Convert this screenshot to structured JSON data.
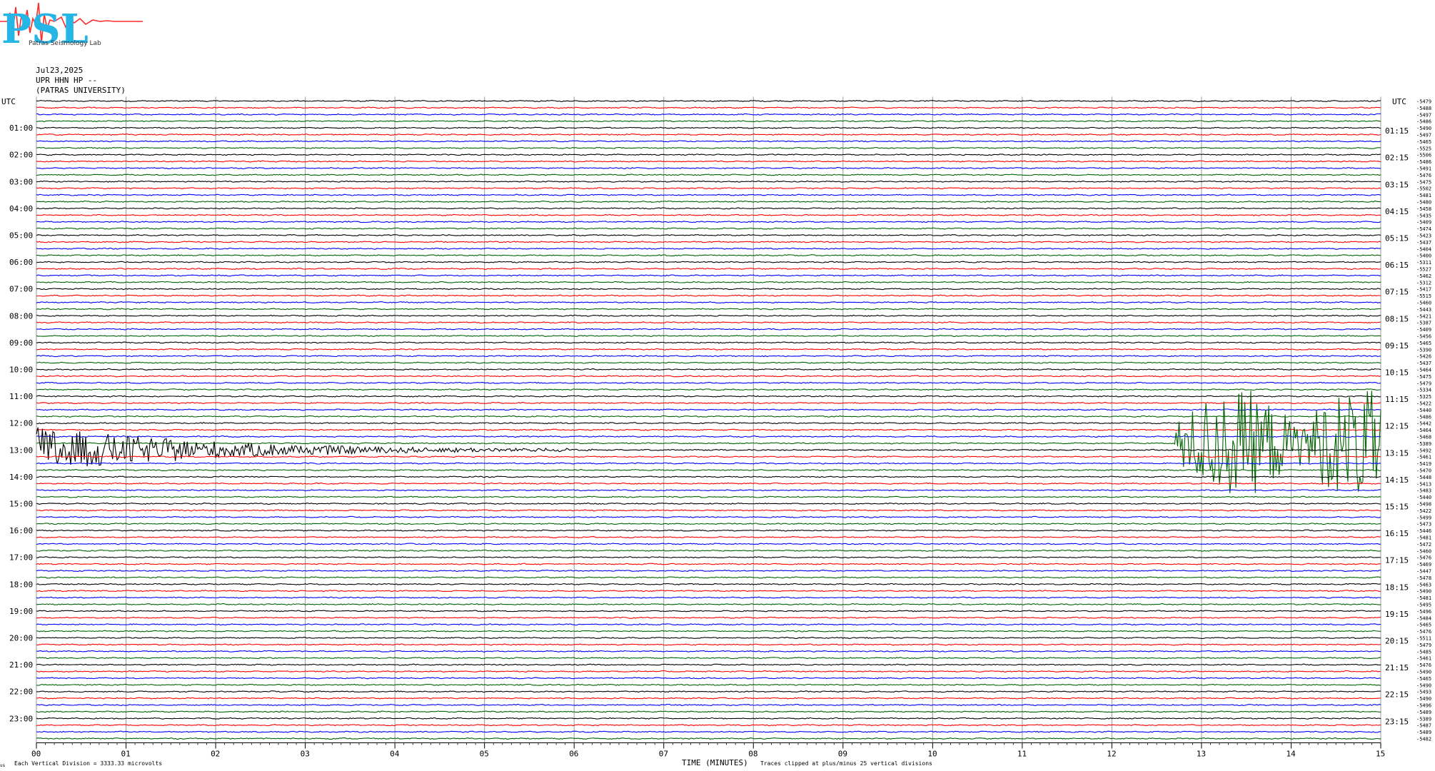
{
  "header": {
    "logo_text": "PSL",
    "logo_subtext": "Patras Seismology Lab",
    "date": "Jul23,2025",
    "station": "UPR HHN HP --",
    "institution": "(PATRAS UNIVERSITY)"
  },
  "axes": {
    "left_unit": "UTC",
    "right_unit": "UTC",
    "xlabel": "TIME (MINUTES)",
    "footer_left": "Each Vertical Division = 3333.33 microvolts",
    "footer_right": "Traces clipped at plus/minus 25 vertical divisions",
    "corner_mark": "us"
  },
  "chart_data": {
    "type": "line",
    "xlim": [
      0,
      15
    ],
    "x_ticks": [
      "00",
      "01",
      "02",
      "03",
      "04",
      "05",
      "06",
      "07",
      "08",
      "09",
      "10",
      "11",
      "12",
      "13",
      "14",
      "15"
    ],
    "grid": "vertical",
    "trace_count": 96,
    "trace_minutes": 15,
    "trace_colors": [
      "#000000",
      "#ff0000",
      "#0000ff",
      "#006400"
    ],
    "left_hour_labels": [
      "01:00",
      "02:00",
      "03:00",
      "04:00",
      "05:00",
      "06:00",
      "07:00",
      "08:00",
      "09:00",
      "10:00",
      "11:00",
      "12:00",
      "13:00",
      "14:00",
      "15:00",
      "16:00",
      "17:00",
      "18:00",
      "19:00",
      "20:00",
      "21:00",
      "22:00",
      "23:00"
    ],
    "right_hour_labels": [
      "01:15",
      "02:15",
      "03:15",
      "04:15",
      "05:15",
      "06:15",
      "07:15",
      "08:15",
      "09:15",
      "10:15",
      "11:15",
      "12:15",
      "13:15",
      "14:15",
      "15:15",
      "16:15",
      "17:15",
      "18:15",
      "19:15",
      "20:15",
      "21:15",
      "22:15",
      "23:15"
    ],
    "trace_offsets": [
      "-5479",
      "-5488",
      "-5497",
      "-5486",
      "-5490",
      "-5497",
      "-5465",
      "-5525",
      "-5506",
      "-5486",
      "-5491",
      "-5476",
      "-5475",
      "-5502",
      "-5481",
      "-5480",
      "-5458",
      "-5435",
      "-5409",
      "-5474",
      "-5423",
      "-5437",
      "-5404",
      "-5400",
      "-5311",
      "-5527",
      "-5462",
      "-5312",
      "-5417",
      "-5515",
      "-5460",
      "-5443",
      "-5421",
      "-5387",
      "-5409",
      "-5456",
      "-5465",
      "-5390",
      "-5426",
      "-5437",
      "-5464",
      "-5475",
      "-5479",
      "-5334",
      "-5325",
      "-5422",
      "-5440",
      "-5486",
      "-5442",
      "-5464",
      "-5468",
      "-5389",
      "-5492",
      "-5461",
      "-5419",
      "-5470",
      "-5448",
      "-5413",
      "-5483",
      "-5440",
      "-5498",
      "-5422",
      "-5499",
      "-5473",
      "-5446",
      "-5481",
      "-5472",
      "-5460",
      "-5476",
      "-5469",
      "-5447",
      "-5478",
      "-5463",
      "-5490",
      "-5481",
      "-5495",
      "-5496",
      "-5484",
      "-5465",
      "-5476",
      "-5511",
      "-5479",
      "-5485",
      "-5461",
      "-5476",
      "-5490",
      "-5465",
      "-5490",
      "-5493",
      "-5490",
      "-5496",
      "-5489",
      "-5389",
      "-5487",
      "-5489",
      "-5482"
    ],
    "events": [
      {
        "trace": 52,
        "start_min": 0.0,
        "end_min": 6.2,
        "peak_divisions": 7,
        "decay": "exponential"
      },
      {
        "trace": 51,
        "start_min": 12.7,
        "end_min": 15.0,
        "peak_divisions": 16,
        "decay": "sustained"
      }
    ]
  }
}
